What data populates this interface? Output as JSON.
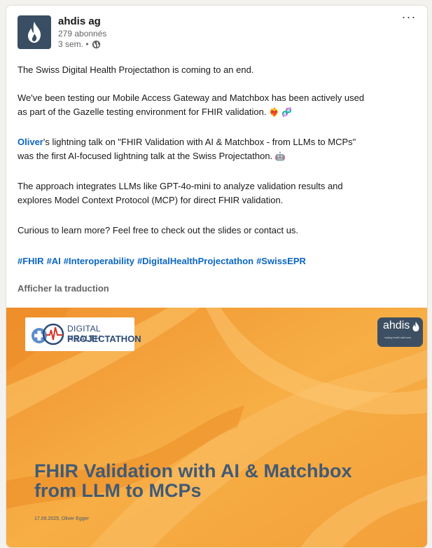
{
  "post": {
    "author_name": "ahdis ag",
    "followers": "279 abonnés",
    "time": "3 sem. •",
    "more": "···",
    "paragraphs": {
      "p1": "The Swiss Digital Health Projectathon is coming to an end.",
      "p2_line1": "We've been testing our Mobile Access Gateway and Matchbox has been actively used",
      "p2_line2": "as part of the Gazelle testing environment for FHIR validation.",
      "p3_mention": "Oliver",
      "p3_line1_rest": "'s lightning talk on \"FHIR Validation with AI & Matchbox - from LLMs to MCPs\"",
      "p3_line2": "was the first AI-focused lightning talk at the Swiss Projectathon.",
      "p4_line1": "The approach integrates LLMs like GPT-4o-mini to analyze validation results and",
      "p4_line2": "explores Model Context Protocol (MCP) for direct FHIR validation.",
      "p5": "Curious to learn more? Feel free to check out the slides or contact us."
    },
    "emojis": {
      "p2": "❤️‍🔥 🧬",
      "p3": "🤖"
    },
    "hashtags": [
      "#FHIR",
      "#AI",
      "#Interoperability",
      "#DigitalHealthProjectathon",
      "#SwissEPR"
    ],
    "translate_label": "Afficher la traduction"
  },
  "slide": {
    "logo_line1": "DIGITAL HEALTH",
    "logo_line2": "PROJECTATHON",
    "brand": "ahdis",
    "brand_tagline": "making health data work",
    "title_line1": "FHIR Validation with AI & Matchbox",
    "title_line2": "from LLM to MCPs",
    "subtitle": "17.09.2025, Oliver Egger"
  },
  "colors": {
    "link": "#0a66c2",
    "slide_title": "#415a75",
    "slide_bg": "#f6a93a",
    "avatar_bg": "#3a4e63"
  }
}
